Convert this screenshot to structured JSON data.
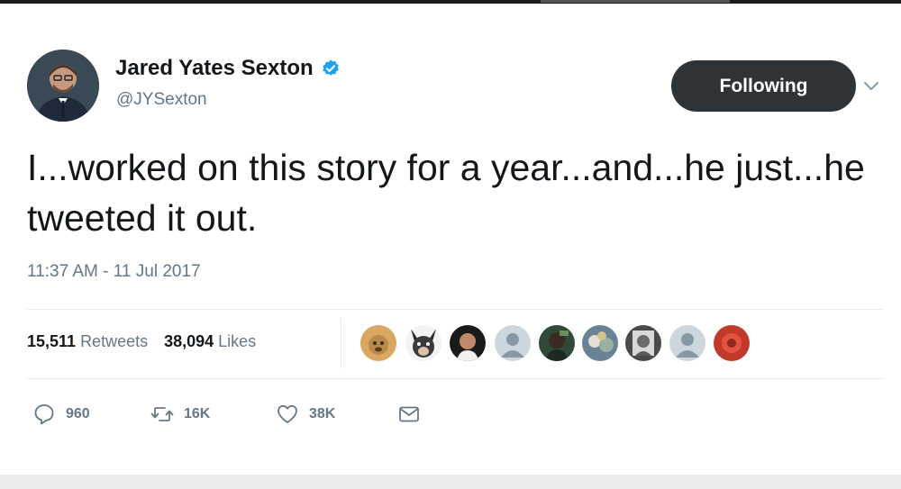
{
  "user": {
    "name": "Jared Yates Sexton",
    "handle": "@JYSexton",
    "verified": true
  },
  "follow_button": {
    "label": "Following"
  },
  "tweet": {
    "text": "I...worked on this story for a year...and...he just...he tweeted it out.",
    "timestamp": "11:37 AM - 11 Jul 2017"
  },
  "stats": {
    "retweets_count": "15,511",
    "retweets_label": "Retweets",
    "likes_count": "38,094",
    "likes_label": "Likes"
  },
  "actions": {
    "reply_count": "960",
    "retweet_count": "16K",
    "like_count": "38K"
  },
  "colors": {
    "verified_blue": "#1da1f2",
    "muted_text": "#657786",
    "button_dark": "#2e3338"
  }
}
